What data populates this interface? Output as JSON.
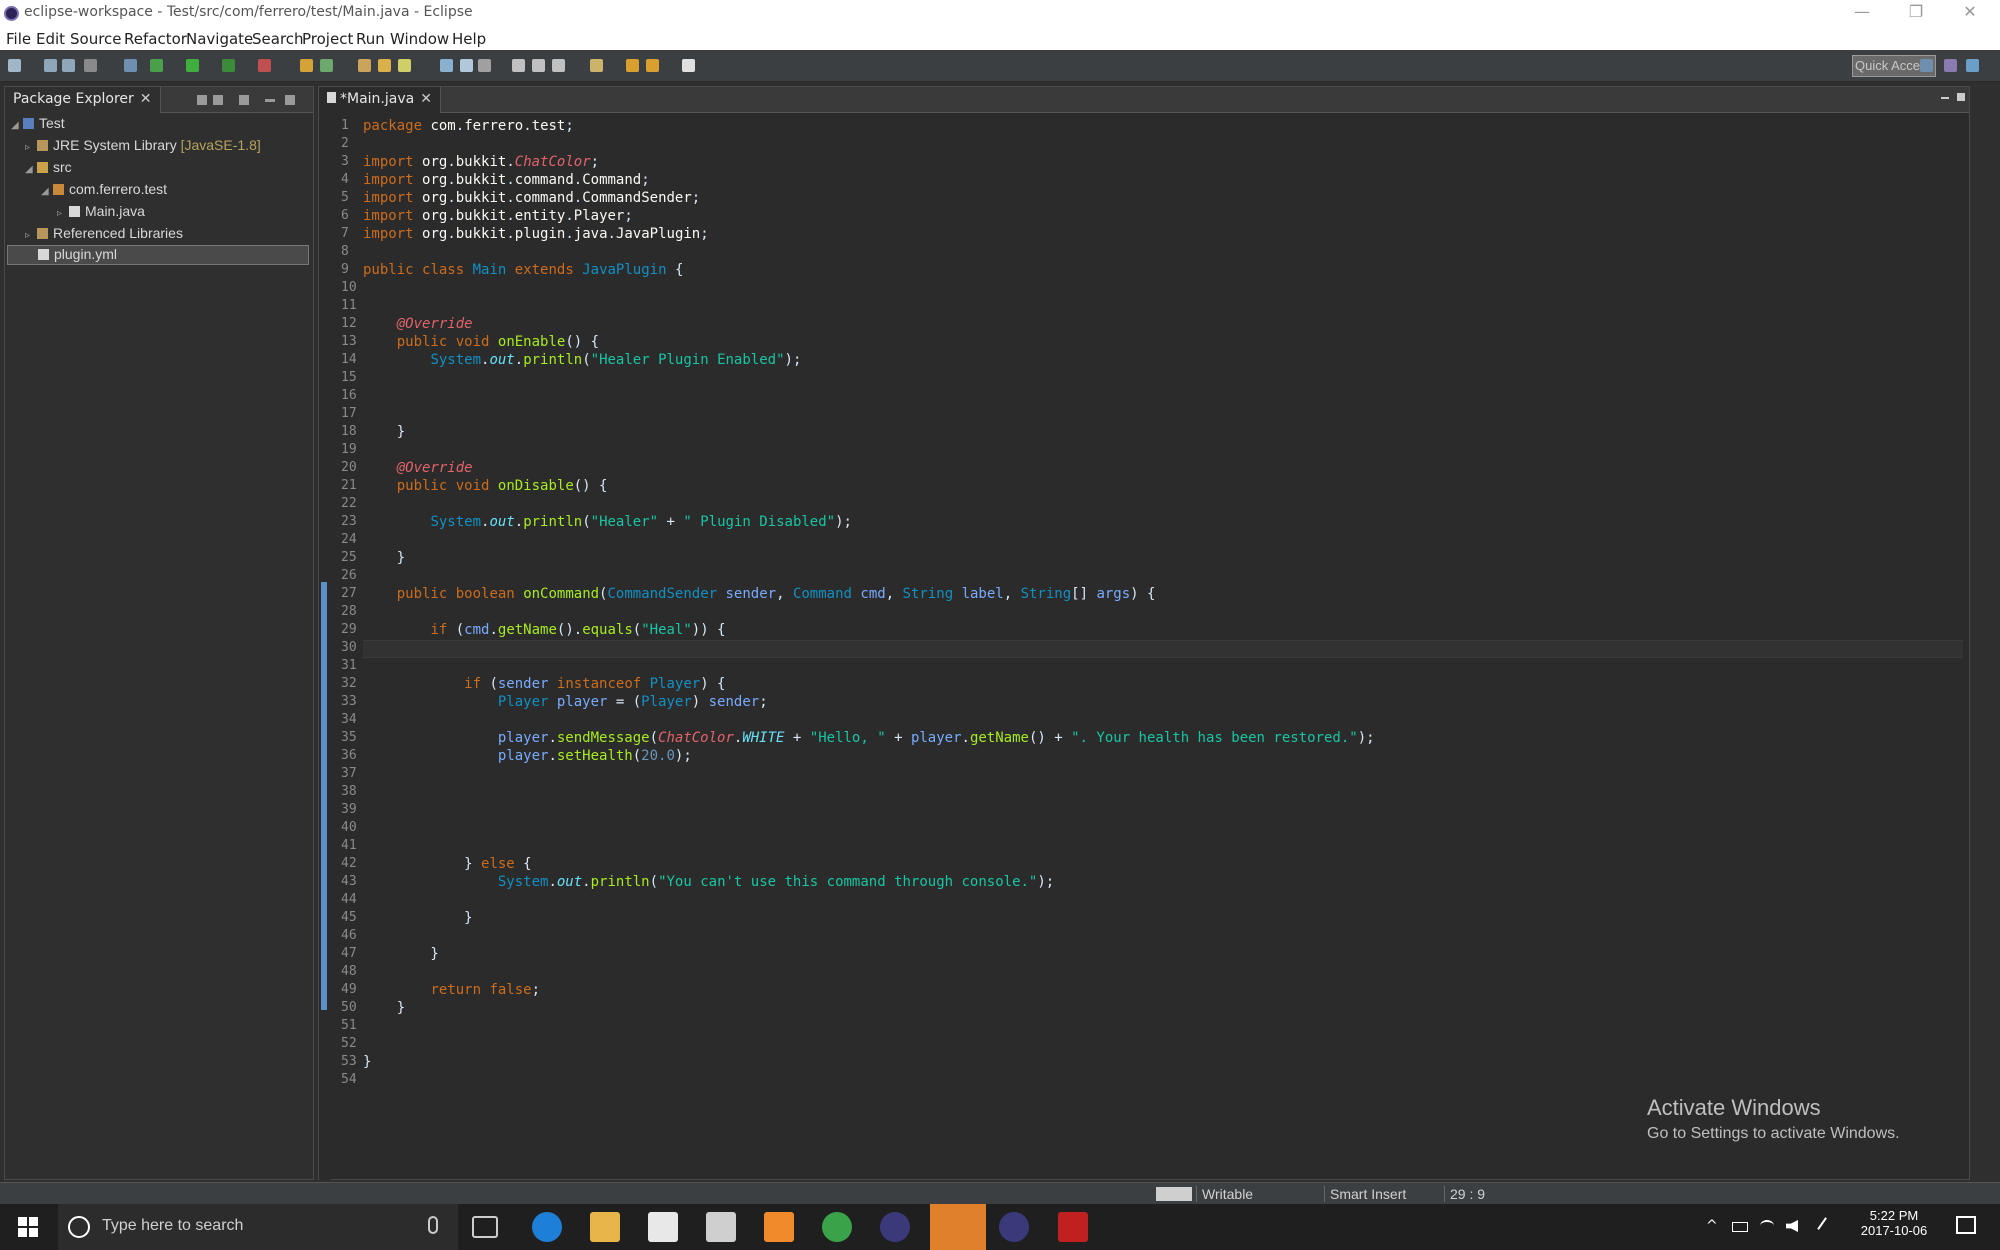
{
  "window": {
    "title": "eclipse-workspace - Test/src/com/ferrero/test/Main.java - Eclipse",
    "minimize": "—",
    "restore": "❐",
    "close": "✕"
  },
  "menu": [
    "File",
    "Edit",
    "Source",
    "Refactor",
    "Navigate",
    "Search",
    "Project",
    "Run",
    "Window",
    "Help"
  ],
  "toolbar": {
    "quick_access": "Quick Access"
  },
  "package_explorer": {
    "tab_label": "Package Explorer",
    "tab_close": "✕",
    "tree": [
      {
        "label": "Test",
        "decoration": "",
        "level": 0
      },
      {
        "label": "JRE System Library",
        "decoration": "[JavaSE-1.8]",
        "level": 1
      },
      {
        "label": "src",
        "decoration": "",
        "level": 1
      },
      {
        "label": "com.ferrero.test",
        "decoration": "",
        "level": 2
      },
      {
        "label": "Main.java",
        "decoration": "",
        "level": 3
      },
      {
        "label": "Referenced Libraries",
        "decoration": "",
        "level": 1
      },
      {
        "label": "plugin.yml",
        "decoration": "",
        "level": 1
      }
    ]
  },
  "editor": {
    "tab_label": "*Main.java",
    "tab_close": "✕",
    "line_numbers": [
      "1",
      "2",
      "3",
      "4",
      "5",
      "6",
      "7",
      "8",
      "9",
      "10",
      "11",
      "12",
      "13",
      "14",
      "15",
      "16",
      "17",
      "18",
      "19",
      "20",
      "21",
      "22",
      "23",
      "24",
      "25",
      "26",
      "27",
      "28",
      "29",
      "30",
      "31",
      "32",
      "33",
      "34",
      "35",
      "36",
      "37",
      "38",
      "39",
      "40",
      "41",
      "42",
      "43",
      "44",
      "45",
      "46",
      "47",
      "48",
      "49",
      "50",
      "51",
      "52",
      "53",
      "54"
    ],
    "code": [
      "package com.ferrero.test;",
      "",
      "import org.bukkit.ChatColor;",
      "import org.bukkit.command.Command;",
      "import org.bukkit.command.CommandSender;",
      "import org.bukkit.entity.Player;",
      "import org.bukkit.plugin.java.JavaPlugin;",
      "",
      "public class Main extends JavaPlugin {",
      "",
      "",
      "    @Override",
      "    public void onEnable() {",
      "        System.out.println(\"Healer Plugin Enabled\");",
      "",
      "",
      "",
      "    }",
      "",
      "    @Override",
      "    public void onDisable() {",
      "",
      "        System.out.println(\"Healer\" + \" Plugin Disabled\");",
      "",
      "    }",
      "",
      "    public boolean onCommand(CommandSender sender, Command cmd, String label, String[] args) {",
      "",
      "        if (cmd.getName().equals(\"Heal\")) {",
      "",
      "",
      "            if (sender instanceof Player) {",
      "                Player player = (Player) sender;",
      "",
      "                player.sendMessage(ChatColor.WHITE + \"Hello, \" + player.getName() + \". Your health has been restored.\");",
      "                player.setHealth(20.0);",
      "",
      "",
      "",
      "",
      "",
      "            } else {",
      "                System.out.println(\"You can't use this command through console.\");",
      "",
      "            }",
      "",
      "        }",
      "",
      "        return false;",
      "    }",
      "",
      "",
      "}",
      ""
    ]
  },
  "watermark": {
    "line1": "Activate Windows",
    "line2": "Go to Settings to activate Windows."
  },
  "status": {
    "writable": "Writable",
    "insert_mode": "Smart Insert",
    "position": "29 : 9"
  },
  "taskbar": {
    "search_placeholder": "Type here to search",
    "time": "5:22 PM",
    "date": "2017-10-06"
  },
  "colors": {
    "keyword": "#cc6c1d",
    "type": "#1290c3",
    "string": "#17c6a3",
    "annotation": "#e3636b",
    "method": "#a7ec21",
    "field": "#66e1f8",
    "variable": "#79abff"
  }
}
